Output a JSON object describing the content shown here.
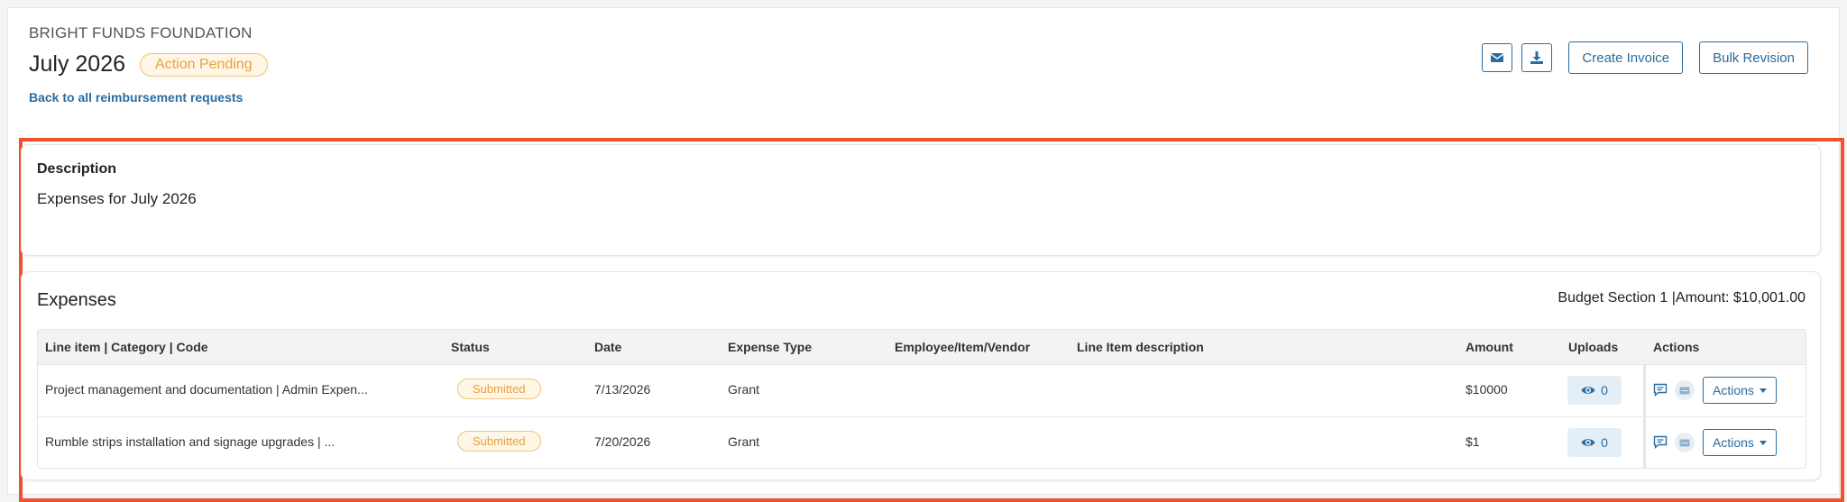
{
  "header": {
    "org": "BRIGHT FUNDS FOUNDATION",
    "title": "July 2026",
    "status": "Action Pending",
    "back_link": "Back to all reimbursement requests",
    "buttons": {
      "email_icon": "envelope-icon",
      "download_icon": "download-icon",
      "create_invoice": "Create Invoice",
      "bulk_revision": "Bulk Revision"
    }
  },
  "description": {
    "label": "Description",
    "text": "Expenses for July 2026"
  },
  "expenses": {
    "title": "Expenses",
    "budget_summary": "Budget Section 1 |Amount: $10,001.00",
    "columns": [
      "Line item | Category | Code",
      "Status",
      "Date",
      "Expense Type",
      "Employee/Item/Vendor",
      "Line Item description",
      "Amount",
      "Uploads",
      "Actions"
    ],
    "rows": [
      {
        "line_item": "Project management and documentation | Admin Expen...",
        "status": "Submitted",
        "date": "7/13/2026",
        "expense_type": "Grant",
        "vendor": "",
        "line_desc": "",
        "amount": "$10000",
        "uploads": "0",
        "actions": "Actions"
      },
      {
        "line_item": "Rumble strips installation and signage upgrades | ...",
        "status": "Submitted",
        "date": "7/20/2026",
        "expense_type": "Grant",
        "vendor": "",
        "line_desc": "",
        "amount": "$1",
        "uploads": "0",
        "actions": "Actions"
      }
    ]
  },
  "colors": {
    "accent": "#2b6c9e",
    "pending": "#e8a23a",
    "highlight": "#f0532b"
  }
}
